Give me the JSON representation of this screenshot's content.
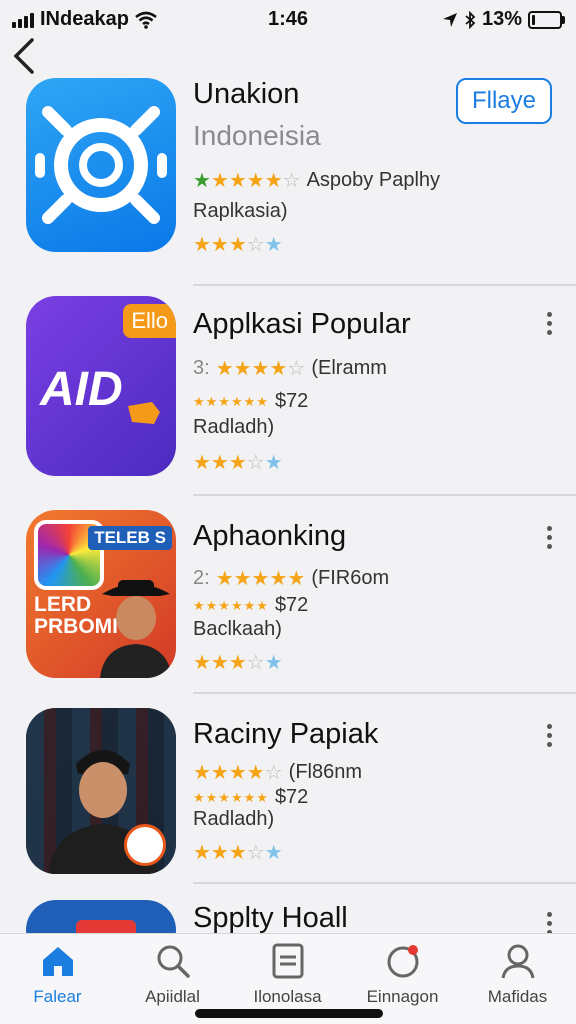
{
  "status_bar": {
    "carrier": "INdeakap",
    "time": "1:46",
    "battery": "13%",
    "battery_level": 0.13
  },
  "top_app": {
    "title": "Unakion",
    "subtitle": "Indoneisia",
    "rating_text": "Aspoby Paplhy",
    "category": "Raplkasia)",
    "get_label": "Fllaye"
  },
  "apps": [
    {
      "title": "Applkasi Popular",
      "rank": "3:",
      "rating_text": "(Elramm",
      "price": "$72",
      "sub": "Radladh)",
      "badge": "Ello",
      "icon_text": "AID"
    },
    {
      "title": "Aphaonking",
      "rank": "2:",
      "rating_text": "(FIR6om",
      "price": "$72",
      "sub": "Baclkaah)",
      "badge": "TELEB S",
      "icon_text": "LERD PRBOMI"
    },
    {
      "title": "Raciny Papiak",
      "rating_text": "(Fl86nm",
      "price": "$72",
      "sub": "Radladh)"
    },
    {
      "title": "Spplty Hoall"
    }
  ],
  "tabs": [
    {
      "label": "Falear",
      "icon": "home-icon"
    },
    {
      "label": "Apiidlal",
      "icon": "search-icon"
    },
    {
      "label": "Ilonolasa",
      "icon": "document-icon"
    },
    {
      "label": "Einnagon",
      "icon": "notification-icon"
    },
    {
      "label": "Mafidas",
      "icon": "profile-icon"
    }
  ],
  "colors": {
    "accent": "#1b7de0",
    "star": "#f4a416",
    "badge": "#e53935"
  }
}
